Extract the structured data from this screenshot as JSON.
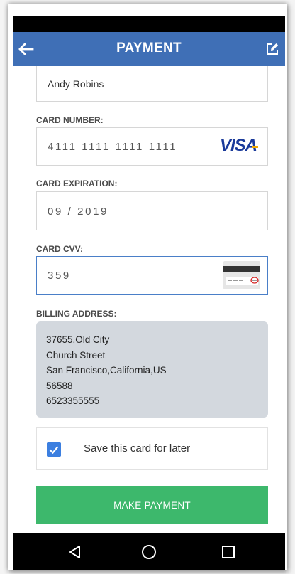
{
  "app_bar": {
    "title": "PAYMENT",
    "color": "#3f6fb6"
  },
  "form": {
    "name_value": "Andy Robins",
    "card_number_label": "CARD NUMBER:",
    "card_number_value": "4111 1111 1111 1111",
    "card_brand": "VISA",
    "card_expiration_label": "CARD EXPIRATION:",
    "card_expiration_value": "09 / 2019",
    "card_cvv_label": "CARD CVV:",
    "card_cvv_value": "359",
    "billing_address_label": "BILLING ADDRESS:",
    "billing_address_lines": [
      "37655,Old City",
      "Church Street",
      "San Francisco,California,US",
      "56588",
      "6523355555"
    ]
  },
  "save_card": {
    "label": "Save this card for later",
    "checked": true
  },
  "make_payment": {
    "label": "MAKE PAYMENT",
    "color": "#3db86c"
  },
  "icons": {
    "back": "arrow-back-icon",
    "edit": "edit-icon",
    "nav": [
      "back-triangle-icon",
      "home-circle-icon",
      "recents-square-icon"
    ]
  }
}
